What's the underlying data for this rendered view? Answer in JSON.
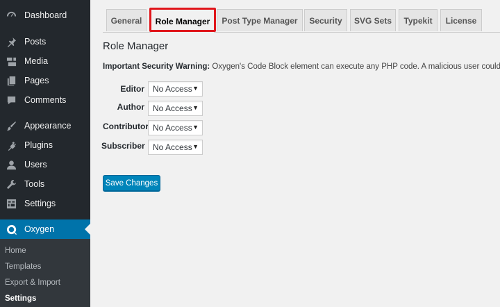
{
  "sidebar": {
    "items": [
      {
        "label": "Dashboard",
        "icon": "dashboard-icon"
      },
      {
        "label": "Posts",
        "icon": "pin-icon"
      },
      {
        "label": "Media",
        "icon": "media-icon"
      },
      {
        "label": "Pages",
        "icon": "pages-icon"
      },
      {
        "label": "Comments",
        "icon": "comment-icon"
      },
      {
        "label": "Appearance",
        "icon": "brush-icon"
      },
      {
        "label": "Plugins",
        "icon": "plug-icon"
      },
      {
        "label": "Users",
        "icon": "user-icon"
      },
      {
        "label": "Tools",
        "icon": "wrench-icon"
      },
      {
        "label": "Settings",
        "icon": "settings-icon"
      },
      {
        "label": "Oxygen",
        "icon": "oxygen-icon"
      }
    ],
    "submenu": [
      "Home",
      "Templates",
      "Export & Import",
      "Settings"
    ],
    "active_color": "#0073aa"
  },
  "tabs": [
    "General",
    "Role Manager",
    "Post Type Manager",
    "Security",
    "SVG Sets",
    "Typekit",
    "License"
  ],
  "active_tab": "Role Manager",
  "highlight_color": "#e0161b",
  "page_title": "Role Manager",
  "warning": {
    "bold": "Important Security Warning:",
    "text": " Oxygen's Code Block element can execute any PHP code. A malicious user could use this to"
  },
  "roles": [
    {
      "label": "Editor",
      "value": "No Access"
    },
    {
      "label": "Author",
      "value": "No Access"
    },
    {
      "label": "Contributor",
      "value": "No Access"
    },
    {
      "label": "Subscriber",
      "value": "No Access"
    }
  ],
  "save_button": "Save Changes"
}
